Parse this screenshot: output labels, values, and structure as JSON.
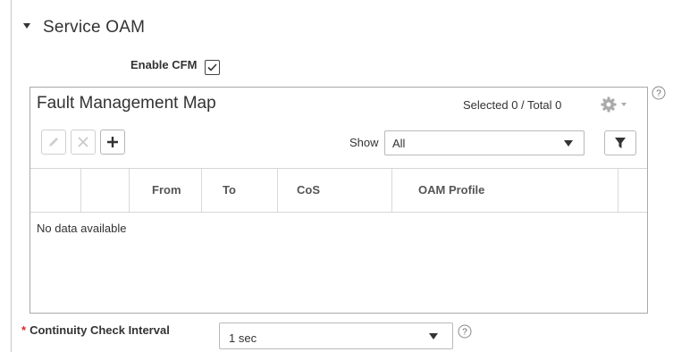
{
  "section": {
    "title": "Service OAM",
    "enable_cfm_label": "Enable CFM",
    "enable_cfm_checked": true
  },
  "fault_map": {
    "title": "Fault Management Map",
    "count_text": "Selected 0 / Total 0",
    "toolbar": {
      "edit_icon": "pencil-icon",
      "delete_icon": "close-icon",
      "add_icon": "plus-icon",
      "show_label": "Show",
      "show_value": "All",
      "filter_icon": "filter-icon"
    },
    "columns": [
      "",
      "",
      "From",
      "To",
      "CoS",
      "OAM Profile",
      ""
    ],
    "empty_text": "No data available"
  },
  "continuity_check": {
    "label": "Continuity Check Interval",
    "required_mark": "*",
    "value": "1 sec"
  },
  "colors": {
    "required": "#d62a2a",
    "border": "#a9a9a9",
    "icon_gray": "#aaaaaa"
  }
}
